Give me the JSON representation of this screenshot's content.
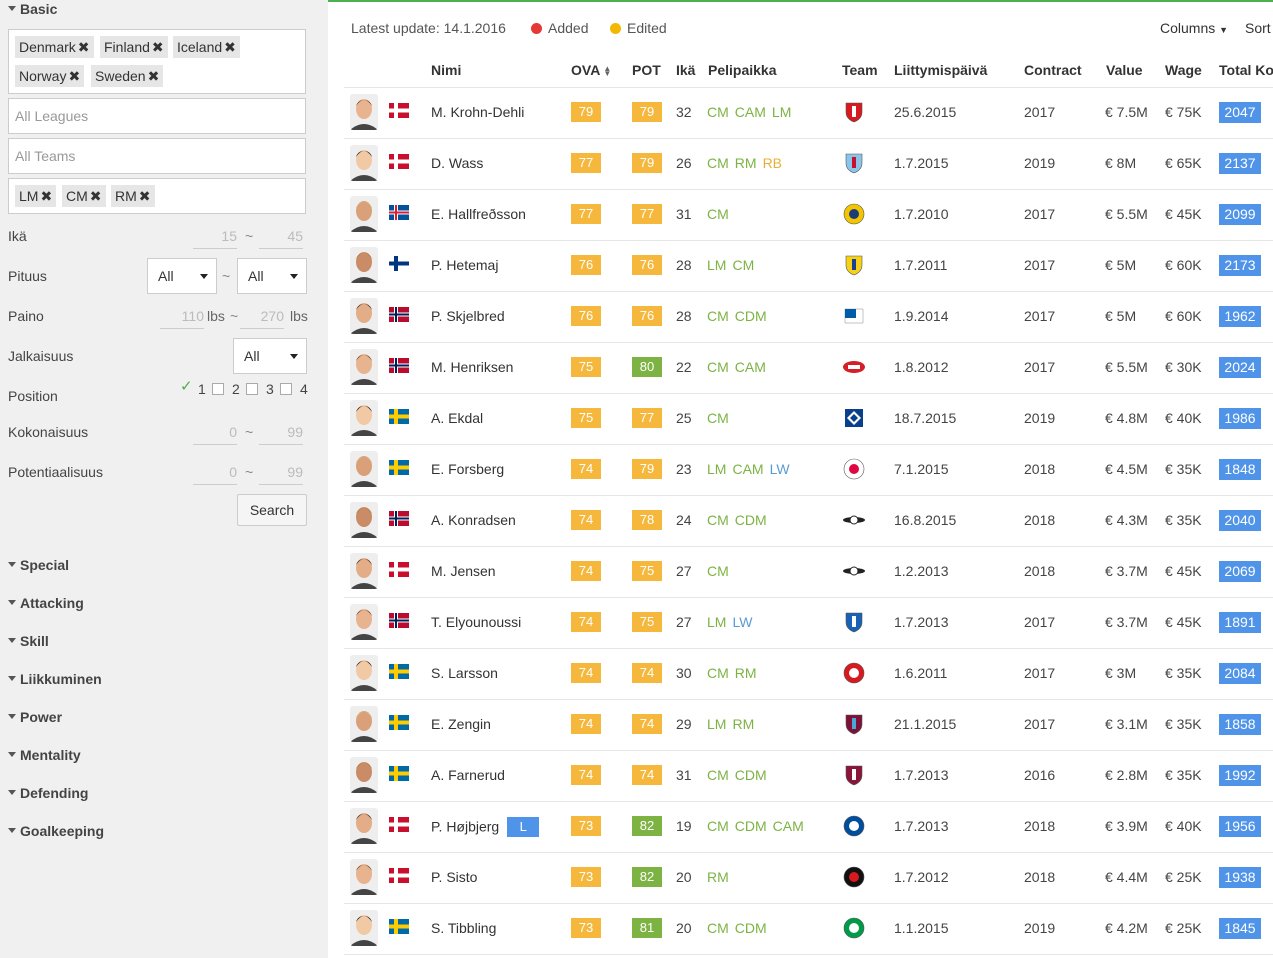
{
  "sidebar": {
    "basic_title": "Basic",
    "nations": [
      "Denmark",
      "Finland",
      "Iceland",
      "Norway",
      "Sweden"
    ],
    "leagues_placeholder": "All Leagues",
    "teams_placeholder": "All Teams",
    "positions": [
      "LM",
      "CM",
      "RM"
    ],
    "ika": {
      "label": "Ikä",
      "min": "15",
      "max": "45"
    },
    "pituus": {
      "label": "Pituus",
      "min": "All",
      "max": "All"
    },
    "paino": {
      "label": "Paino",
      "min": "110",
      "max": "270",
      "unit": "lbs"
    },
    "jalkaisuus": {
      "label": "Jalkaisuus",
      "value": "All"
    },
    "position": {
      "label": "Position",
      "options": [
        "1",
        "2",
        "3",
        "4"
      ],
      "checked": "1"
    },
    "kokonaisuus": {
      "label": "Kokonaisuus",
      "min": "0",
      "max": "99"
    },
    "potentiaalisuus": {
      "label": "Potentiaalisuus",
      "min": "0",
      "max": "99"
    },
    "tilde": "~",
    "search_label": "Search",
    "sections": [
      "Special",
      "Attacking",
      "Skill",
      "Liikkuminen",
      "Power",
      "Mentality",
      "Defending",
      "Goalkeeping"
    ]
  },
  "main": {
    "latest_update": "Latest update: 14.1.2016",
    "legend_added": "Added",
    "legend_edited": "Edited",
    "columns_label": "Columns",
    "sort_label": "Sort",
    "colors": {
      "added": "#e53935",
      "edited": "#f5b800",
      "ova": "#f5b83d",
      "pot_orange": "#f5b83d",
      "pot_green": "#7cb342",
      "pos_green": "#7cb342",
      "pos_orange": "#e8b03a",
      "pos_blue": "#5b9bd5",
      "total": "#4f94e8"
    },
    "headers": {
      "name": "Nimi",
      "ova": "OVA",
      "pot": "POT",
      "age": "Ikä",
      "positions": "Pelipaikka",
      "team": "Team",
      "joined": "Liittymispäivä",
      "contract": "Contract",
      "value": "Value",
      "wage": "Wage",
      "total": "Total Ko"
    },
    "players": [
      {
        "name": "M. Krohn-Dehli",
        "flag": "DK",
        "ova": "79",
        "pot": "79",
        "potc": "o",
        "age": "32",
        "pos": [
          [
            "CM",
            "g"
          ],
          [
            "CAM",
            "g"
          ],
          [
            "LM",
            "g"
          ]
        ],
        "team": "sevilla",
        "joined": "25.6.2015",
        "contract": "2017",
        "value": "€ 7.5M",
        "wage": "€ 75K",
        "total": "2047"
      },
      {
        "name": "D. Wass",
        "flag": "DK",
        "ova": "77",
        "pot": "79",
        "potc": "o",
        "age": "26",
        "pos": [
          [
            "CM",
            "g"
          ],
          [
            "RM",
            "g"
          ],
          [
            "RB",
            "o"
          ]
        ],
        "team": "celta",
        "joined": "1.7.2015",
        "contract": "2019",
        "value": "€ 8M",
        "wage": "€ 65K",
        "total": "2137"
      },
      {
        "name": "E. Hallfreðsson",
        "flag": "IS",
        "ova": "77",
        "pot": "77",
        "potc": "o",
        "age": "31",
        "pos": [
          [
            "CM",
            "g"
          ]
        ],
        "team": "verona",
        "joined": "1.7.2010",
        "contract": "2017",
        "value": "€ 5.5M",
        "wage": "€ 45K",
        "total": "2099"
      },
      {
        "name": "P. Hetemaj",
        "flag": "FI",
        "ova": "76",
        "pot": "76",
        "potc": "o",
        "age": "28",
        "pos": [
          [
            "LM",
            "g"
          ],
          [
            "CM",
            "g"
          ]
        ],
        "team": "chievo",
        "joined": "1.7.2011",
        "contract": "2017",
        "value": "€ 5M",
        "wage": "€ 60K",
        "total": "2173"
      },
      {
        "name": "P. Skjelbred",
        "flag": "NO",
        "ova": "76",
        "pot": "76",
        "potc": "o",
        "age": "28",
        "pos": [
          [
            "CM",
            "g"
          ],
          [
            "CDM",
            "g"
          ]
        ],
        "team": "hertha",
        "joined": "1.9.2014",
        "contract": "2017",
        "value": "€ 5M",
        "wage": "€ 60K",
        "total": "1962"
      },
      {
        "name": "M. Henriksen",
        "flag": "NO",
        "ova": "75",
        "pot": "80",
        "potc": "g",
        "age": "22",
        "pos": [
          [
            "CM",
            "g"
          ],
          [
            "CAM",
            "g"
          ]
        ],
        "team": "az",
        "joined": "1.8.2012",
        "contract": "2017",
        "value": "€ 5.5M",
        "wage": "€ 30K",
        "total": "2024"
      },
      {
        "name": "A. Ekdal",
        "flag": "SE",
        "ova": "75",
        "pot": "77",
        "potc": "o",
        "age": "25",
        "pos": [
          [
            "CM",
            "g"
          ]
        ],
        "team": "hamburg",
        "joined": "18.7.2015",
        "contract": "2019",
        "value": "€ 4.8M",
        "wage": "€ 40K",
        "total": "1986"
      },
      {
        "name": "E. Forsberg",
        "flag": "SE",
        "ova": "74",
        "pot": "79",
        "potc": "o",
        "age": "23",
        "pos": [
          [
            "LM",
            "g"
          ],
          [
            "CAM",
            "g"
          ],
          [
            "LW",
            "b"
          ]
        ],
        "team": "leipzig",
        "joined": "7.1.2015",
        "contract": "2018",
        "value": "€ 4.5M",
        "wage": "€ 35K",
        "total": "1848"
      },
      {
        "name": "A. Konradsen",
        "flag": "NO",
        "ova": "74",
        "pot": "78",
        "potc": "o",
        "age": "24",
        "pos": [
          [
            "CM",
            "g"
          ],
          [
            "CDM",
            "g"
          ]
        ],
        "team": "rosenborg",
        "joined": "16.8.2015",
        "contract": "2018",
        "value": "€ 4.3M",
        "wage": "€ 35K",
        "total": "2040"
      },
      {
        "name": "M. Jensen",
        "flag": "DK",
        "ova": "74",
        "pot": "75",
        "potc": "o",
        "age": "27",
        "pos": [
          [
            "CM",
            "g"
          ]
        ],
        "team": "rosenborg",
        "joined": "1.2.2013",
        "contract": "2018",
        "value": "€ 3.7M",
        "wage": "€ 45K",
        "total": "2069"
      },
      {
        "name": "T. Elyounoussi",
        "flag": "NO",
        "ova": "74",
        "pot": "75",
        "potc": "o",
        "age": "27",
        "pos": [
          [
            "LM",
            "g"
          ],
          [
            "LW",
            "b"
          ]
        ],
        "team": "hoffenheim",
        "joined": "1.7.2013",
        "contract": "2017",
        "value": "€ 3.7M",
        "wage": "€ 45K",
        "total": "1891"
      },
      {
        "name": "S. Larsson",
        "flag": "SE",
        "ova": "74",
        "pot": "74",
        "potc": "o",
        "age": "30",
        "pos": [
          [
            "CM",
            "g"
          ],
          [
            "RM",
            "g"
          ]
        ],
        "team": "sunderland",
        "joined": "1.6.2011",
        "contract": "2017",
        "value": "€ 3M",
        "wage": "€ 35K",
        "total": "2084"
      },
      {
        "name": "E. Zengin",
        "flag": "SE",
        "ova": "74",
        "pot": "74",
        "potc": "o",
        "age": "29",
        "pos": [
          [
            "LM",
            "g"
          ],
          [
            "RM",
            "g"
          ]
        ],
        "team": "trabzon",
        "joined": "21.1.2015",
        "contract": "2017",
        "value": "€ 3.1M",
        "wage": "€ 35K",
        "total": "1858"
      },
      {
        "name": "A. Farnerud",
        "flag": "SE",
        "ova": "74",
        "pot": "74",
        "potc": "o",
        "age": "31",
        "pos": [
          [
            "CM",
            "g"
          ],
          [
            "CDM",
            "g"
          ]
        ],
        "team": "torino",
        "joined": "1.7.2013",
        "contract": "2016",
        "value": "€ 2.8M",
        "wage": "€ 35K",
        "total": "1992"
      },
      {
        "name": "P. Højbjerg",
        "badge": "L",
        "flag": "DK",
        "ova": "73",
        "pot": "82",
        "potc": "g",
        "age": "19",
        "pos": [
          [
            "CM",
            "g"
          ],
          [
            "CDM",
            "g"
          ],
          [
            "CAM",
            "g"
          ]
        ],
        "team": "schalke",
        "joined": "1.7.2013",
        "contract": "2018",
        "value": "€ 3.9M",
        "wage": "€ 40K",
        "total": "1956"
      },
      {
        "name": "P. Sisto",
        "flag": "DK",
        "ova": "73",
        "pot": "82",
        "potc": "g",
        "age": "20",
        "pos": [
          [
            "RM",
            "g"
          ]
        ],
        "team": "midtjylland",
        "joined": "1.7.2012",
        "contract": "2018",
        "value": "€ 4.4M",
        "wage": "€ 25K",
        "total": "1938"
      },
      {
        "name": "S. Tibbling",
        "flag": "SE",
        "ova": "73",
        "pot": "81",
        "potc": "g",
        "age": "20",
        "pos": [
          [
            "CM",
            "g"
          ],
          [
            "CDM",
            "g"
          ]
        ],
        "team": "groningen",
        "joined": "1.1.2015",
        "contract": "2019",
        "value": "€ 4.2M",
        "wage": "€ 25K",
        "total": "1845"
      }
    ]
  }
}
